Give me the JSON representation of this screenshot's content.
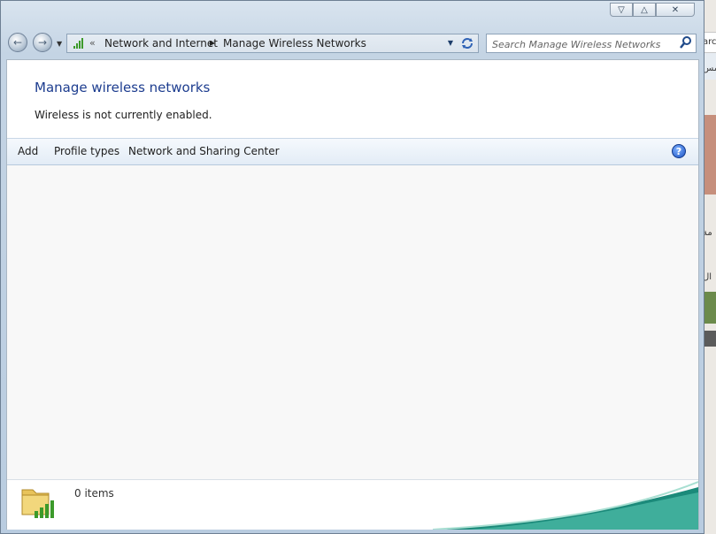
{
  "window": {
    "caption_buttons": {
      "minimize_icon": "chevron-down-icon",
      "maximize_icon": "chevron-up-icon",
      "close_icon": "close-icon",
      "minimize_glyph": "▽",
      "maximize_glyph": "△",
      "close_glyph": "✕"
    }
  },
  "address_bar": {
    "back_glyph": "←",
    "forward_glyph": "→",
    "overflow_chevrons": "«",
    "breadcrumbs": [
      "Network and Internet",
      "Manage Wireless Networks"
    ],
    "search": {
      "placeholder": "Search Manage Wireless Networks"
    }
  },
  "main": {
    "title": "Manage wireless networks",
    "status": "Wireless is not currently enabled."
  },
  "command_bar": {
    "items": [
      "Add",
      "Profile types",
      "Network and Sharing Center"
    ],
    "help_glyph": "?"
  },
  "details_pane": {
    "item_count": "0 items"
  },
  "background_text": {
    "a": "arc",
    "b": "مس",
    "c": "مة",
    "d": "ال"
  },
  "colors": {
    "title_blue": "#1d3d8f",
    "signal_green": "#3c9a2a"
  }
}
